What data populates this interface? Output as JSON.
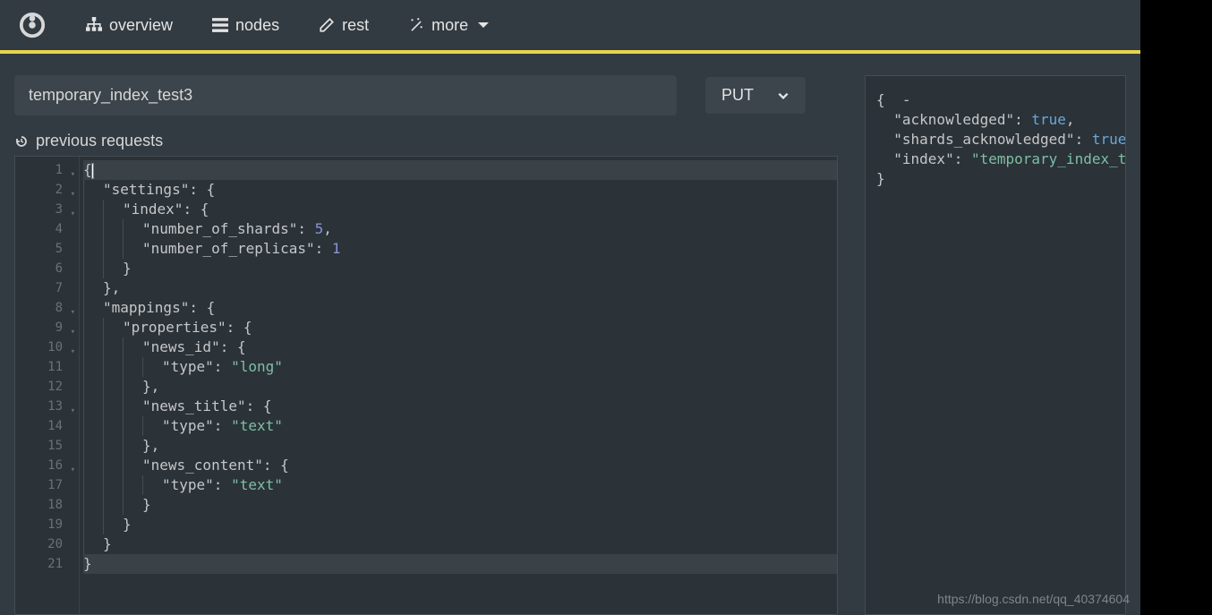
{
  "nav": {
    "overview_label": "overview",
    "nodes_label": "nodes",
    "rest_label": "rest",
    "more_label": "more"
  },
  "request": {
    "path_value": "temporary_index_test3",
    "method_selected": "PUT",
    "previous_label": "previous requests"
  },
  "editor": {
    "lines": [
      {
        "n": 1,
        "fold": true,
        "indent": 0,
        "tokens": [
          {
            "t": "{",
            "c": "punc"
          }
        ],
        "cursor": true
      },
      {
        "n": 2,
        "fold": true,
        "indent": 1,
        "tokens": [
          {
            "t": "\"settings\"",
            "c": "key"
          },
          {
            "t": ": {",
            "c": "punc"
          }
        ]
      },
      {
        "n": 3,
        "fold": true,
        "indent": 2,
        "tokens": [
          {
            "t": "\"index\"",
            "c": "key"
          },
          {
            "t": ": {",
            "c": "punc"
          }
        ]
      },
      {
        "n": 4,
        "fold": false,
        "indent": 3,
        "tokens": [
          {
            "t": "\"number_of_shards\"",
            "c": "key"
          },
          {
            "t": ": ",
            "c": "punc"
          },
          {
            "t": "5",
            "c": "num"
          },
          {
            "t": ",",
            "c": "punc"
          }
        ]
      },
      {
        "n": 5,
        "fold": false,
        "indent": 3,
        "tokens": [
          {
            "t": "\"number_of_replicas\"",
            "c": "key"
          },
          {
            "t": ": ",
            "c": "punc"
          },
          {
            "t": "1",
            "c": "num"
          }
        ]
      },
      {
        "n": 6,
        "fold": false,
        "indent": 2,
        "tokens": [
          {
            "t": "}",
            "c": "punc"
          }
        ]
      },
      {
        "n": 7,
        "fold": false,
        "indent": 1,
        "tokens": [
          {
            "t": "},",
            "c": "punc"
          }
        ]
      },
      {
        "n": 8,
        "fold": true,
        "indent": 1,
        "tokens": [
          {
            "t": "\"mappings\"",
            "c": "key"
          },
          {
            "t": ": {",
            "c": "punc"
          }
        ]
      },
      {
        "n": 9,
        "fold": true,
        "indent": 2,
        "tokens": [
          {
            "t": "\"properties\"",
            "c": "key"
          },
          {
            "t": ": {",
            "c": "punc"
          }
        ]
      },
      {
        "n": 10,
        "fold": true,
        "indent": 3,
        "tokens": [
          {
            "t": "\"news_id\"",
            "c": "key"
          },
          {
            "t": ": {",
            "c": "punc"
          }
        ]
      },
      {
        "n": 11,
        "fold": false,
        "indent": 4,
        "tokens": [
          {
            "t": "\"type\"",
            "c": "key"
          },
          {
            "t": ": ",
            "c": "punc"
          },
          {
            "t": "\"long\"",
            "c": "str"
          }
        ]
      },
      {
        "n": 12,
        "fold": false,
        "indent": 3,
        "tokens": [
          {
            "t": "},",
            "c": "punc"
          }
        ]
      },
      {
        "n": 13,
        "fold": true,
        "indent": 3,
        "tokens": [
          {
            "t": "\"news_title\"",
            "c": "key"
          },
          {
            "t": ": {",
            "c": "punc"
          }
        ]
      },
      {
        "n": 14,
        "fold": false,
        "indent": 4,
        "tokens": [
          {
            "t": "\"type\"",
            "c": "key"
          },
          {
            "t": ": ",
            "c": "punc"
          },
          {
            "t": "\"text\"",
            "c": "str"
          }
        ]
      },
      {
        "n": 15,
        "fold": false,
        "indent": 3,
        "tokens": [
          {
            "t": "},",
            "c": "punc"
          }
        ]
      },
      {
        "n": 16,
        "fold": true,
        "indent": 3,
        "tokens": [
          {
            "t": "\"news_content\"",
            "c": "key"
          },
          {
            "t": ": {",
            "c": "punc"
          }
        ]
      },
      {
        "n": 17,
        "fold": false,
        "indent": 4,
        "tokens": [
          {
            "t": "\"type\"",
            "c": "key"
          },
          {
            "t": ": ",
            "c": "punc"
          },
          {
            "t": "\"text\"",
            "c": "str"
          }
        ]
      },
      {
        "n": 18,
        "fold": false,
        "indent": 3,
        "tokens": [
          {
            "t": "}",
            "c": "punc"
          }
        ]
      },
      {
        "n": 19,
        "fold": false,
        "indent": 2,
        "tokens": [
          {
            "t": "}",
            "c": "punc"
          }
        ]
      },
      {
        "n": 20,
        "fold": false,
        "indent": 1,
        "tokens": [
          {
            "t": "}",
            "c": "punc"
          }
        ]
      },
      {
        "n": 21,
        "fold": false,
        "indent": 0,
        "tokens": [
          {
            "t": "}",
            "c": "punc"
          }
        ],
        "highlight": true
      }
    ]
  },
  "response": {
    "lines": [
      [
        {
          "t": "{  ",
          "c": "punc"
        },
        {
          "t": "-",
          "c": "punc"
        }
      ],
      [
        {
          "t": "  ",
          "c": "punc"
        },
        {
          "t": "\"acknowledged\"",
          "c": "key"
        },
        {
          "t": ": ",
          "c": "punc"
        },
        {
          "t": "true",
          "c": "bool"
        },
        {
          "t": ",",
          "c": "punc"
        }
      ],
      [
        {
          "t": "  ",
          "c": "punc"
        },
        {
          "t": "\"shards_acknowledged\"",
          "c": "key"
        },
        {
          "t": ": ",
          "c": "punc"
        },
        {
          "t": "true",
          "c": "bool"
        }
      ],
      [
        {
          "t": "  ",
          "c": "punc"
        },
        {
          "t": "\"index\"",
          "c": "key"
        },
        {
          "t": ": ",
          "c": "punc"
        },
        {
          "t": "\"temporary_index_t",
          "c": "respstr"
        }
      ],
      [
        {
          "t": "}",
          "c": "punc"
        }
      ]
    ]
  },
  "watermark_text": "https://blog.csdn.net/qq_40374604"
}
